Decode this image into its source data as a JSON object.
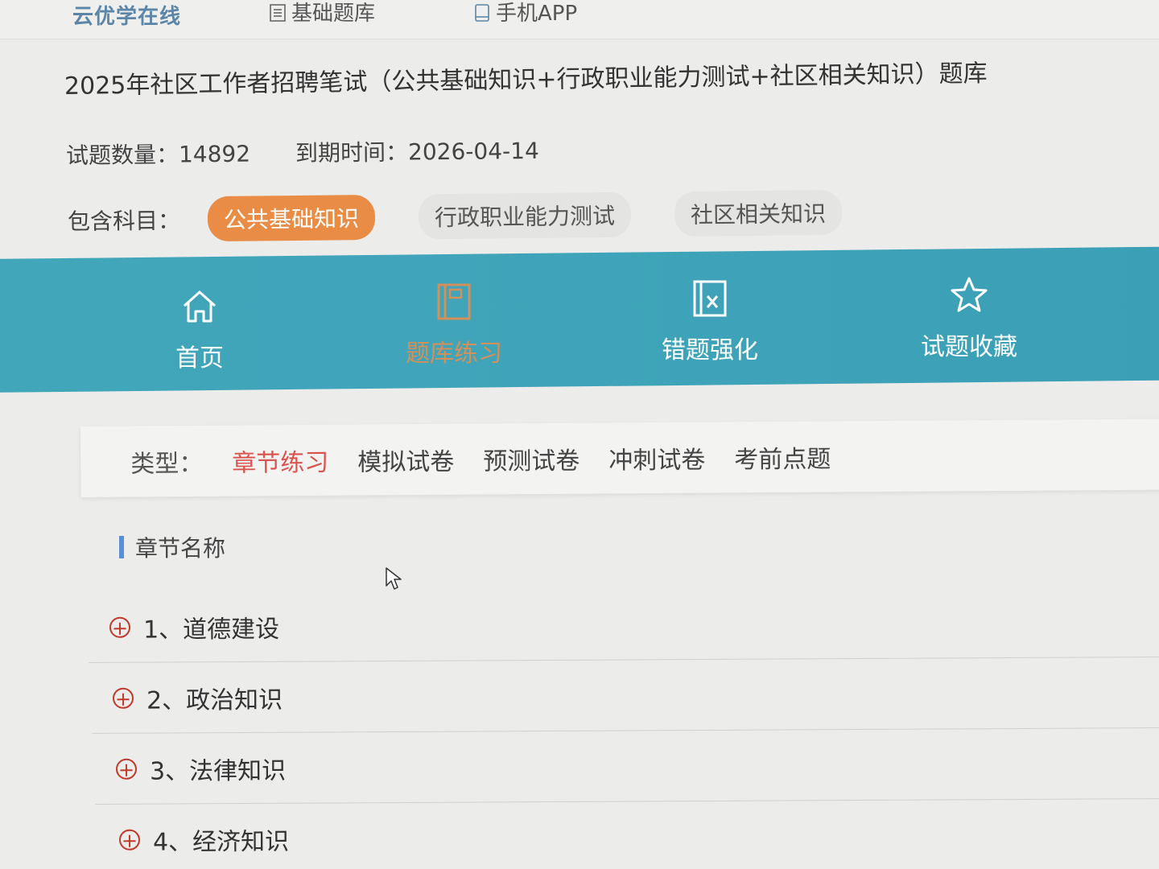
{
  "header": {
    "brand": "云优学在线",
    "nav": [
      {
        "label": "基础题库",
        "icon": "document-icon"
      },
      {
        "label": "手机APP",
        "icon": "phone-icon"
      }
    ]
  },
  "course": {
    "title": "2025年社区工作者招聘笔试（公共基础知识+行政职业能力测试+社区相关知识）题库",
    "count_label": "试题数量：14892",
    "expiry_label": "到期时间：2026-04-14",
    "subjects_label": "包含科目：",
    "subjects": [
      "公共基础知识",
      "行政职业能力测试",
      "社区相关知识"
    ],
    "active_subject": "公共基础知识"
  },
  "main_tabs": [
    {
      "label": "首页",
      "icon": "home-icon"
    },
    {
      "label": "题库练习",
      "icon": "book-icon",
      "active": true
    },
    {
      "label": "错题强化",
      "icon": "wrong-book-icon"
    },
    {
      "label": "试题收藏",
      "icon": "star-icon"
    }
  ],
  "type_filter": {
    "label": "类型：",
    "items": [
      "章节练习",
      "模拟试卷",
      "预测试卷",
      "冲刺试卷",
      "考前点题"
    ],
    "active": "章节练习"
  },
  "chapters": {
    "heading": "章节名称",
    "items": [
      "1、道德建设",
      "2、政治知识",
      "3、法律知识",
      "4、经济知识"
    ]
  },
  "colors": {
    "teal": "#42a6bb",
    "accent_orange": "#e98c45",
    "active_red": "#d9534f"
  }
}
